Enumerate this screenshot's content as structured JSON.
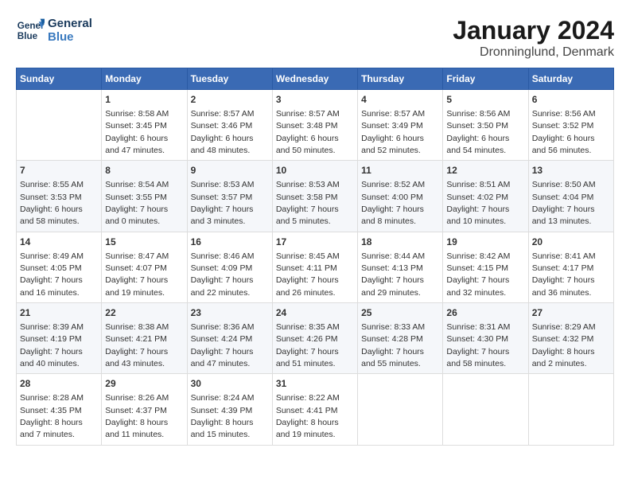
{
  "header": {
    "logo_text_line1": "General",
    "logo_text_line2": "Blue",
    "title": "January 2024",
    "subtitle": "Dronninglund, Denmark"
  },
  "calendar": {
    "days_of_week": [
      "Sunday",
      "Monday",
      "Tuesday",
      "Wednesday",
      "Thursday",
      "Friday",
      "Saturday"
    ],
    "weeks": [
      [
        {
          "day": "",
          "sunrise": "",
          "sunset": "",
          "daylight": ""
        },
        {
          "day": "1",
          "sunrise": "Sunrise: 8:58 AM",
          "sunset": "Sunset: 3:45 PM",
          "daylight": "Daylight: 6 hours and 47 minutes."
        },
        {
          "day": "2",
          "sunrise": "Sunrise: 8:57 AM",
          "sunset": "Sunset: 3:46 PM",
          "daylight": "Daylight: 6 hours and 48 minutes."
        },
        {
          "day": "3",
          "sunrise": "Sunrise: 8:57 AM",
          "sunset": "Sunset: 3:48 PM",
          "daylight": "Daylight: 6 hours and 50 minutes."
        },
        {
          "day": "4",
          "sunrise": "Sunrise: 8:57 AM",
          "sunset": "Sunset: 3:49 PM",
          "daylight": "Daylight: 6 hours and 52 minutes."
        },
        {
          "day": "5",
          "sunrise": "Sunrise: 8:56 AM",
          "sunset": "Sunset: 3:50 PM",
          "daylight": "Daylight: 6 hours and 54 minutes."
        },
        {
          "day": "6",
          "sunrise": "Sunrise: 8:56 AM",
          "sunset": "Sunset: 3:52 PM",
          "daylight": "Daylight: 6 hours and 56 minutes."
        }
      ],
      [
        {
          "day": "7",
          "sunrise": "Sunrise: 8:55 AM",
          "sunset": "Sunset: 3:53 PM",
          "daylight": "Daylight: 6 hours and 58 minutes."
        },
        {
          "day": "8",
          "sunrise": "Sunrise: 8:54 AM",
          "sunset": "Sunset: 3:55 PM",
          "daylight": "Daylight: 7 hours and 0 minutes."
        },
        {
          "day": "9",
          "sunrise": "Sunrise: 8:53 AM",
          "sunset": "Sunset: 3:57 PM",
          "daylight": "Daylight: 7 hours and 3 minutes."
        },
        {
          "day": "10",
          "sunrise": "Sunrise: 8:53 AM",
          "sunset": "Sunset: 3:58 PM",
          "daylight": "Daylight: 7 hours and 5 minutes."
        },
        {
          "day": "11",
          "sunrise": "Sunrise: 8:52 AM",
          "sunset": "Sunset: 4:00 PM",
          "daylight": "Daylight: 7 hours and 8 minutes."
        },
        {
          "day": "12",
          "sunrise": "Sunrise: 8:51 AM",
          "sunset": "Sunset: 4:02 PM",
          "daylight": "Daylight: 7 hours and 10 minutes."
        },
        {
          "day": "13",
          "sunrise": "Sunrise: 8:50 AM",
          "sunset": "Sunset: 4:04 PM",
          "daylight": "Daylight: 7 hours and 13 minutes."
        }
      ],
      [
        {
          "day": "14",
          "sunrise": "Sunrise: 8:49 AM",
          "sunset": "Sunset: 4:05 PM",
          "daylight": "Daylight: 7 hours and 16 minutes."
        },
        {
          "day": "15",
          "sunrise": "Sunrise: 8:47 AM",
          "sunset": "Sunset: 4:07 PM",
          "daylight": "Daylight: 7 hours and 19 minutes."
        },
        {
          "day": "16",
          "sunrise": "Sunrise: 8:46 AM",
          "sunset": "Sunset: 4:09 PM",
          "daylight": "Daylight: 7 hours and 22 minutes."
        },
        {
          "day": "17",
          "sunrise": "Sunrise: 8:45 AM",
          "sunset": "Sunset: 4:11 PM",
          "daylight": "Daylight: 7 hours and 26 minutes."
        },
        {
          "day": "18",
          "sunrise": "Sunrise: 8:44 AM",
          "sunset": "Sunset: 4:13 PM",
          "daylight": "Daylight: 7 hours and 29 minutes."
        },
        {
          "day": "19",
          "sunrise": "Sunrise: 8:42 AM",
          "sunset": "Sunset: 4:15 PM",
          "daylight": "Daylight: 7 hours and 32 minutes."
        },
        {
          "day": "20",
          "sunrise": "Sunrise: 8:41 AM",
          "sunset": "Sunset: 4:17 PM",
          "daylight": "Daylight: 7 hours and 36 minutes."
        }
      ],
      [
        {
          "day": "21",
          "sunrise": "Sunrise: 8:39 AM",
          "sunset": "Sunset: 4:19 PM",
          "daylight": "Daylight: 7 hours and 40 minutes."
        },
        {
          "day": "22",
          "sunrise": "Sunrise: 8:38 AM",
          "sunset": "Sunset: 4:21 PM",
          "daylight": "Daylight: 7 hours and 43 minutes."
        },
        {
          "day": "23",
          "sunrise": "Sunrise: 8:36 AM",
          "sunset": "Sunset: 4:24 PM",
          "daylight": "Daylight: 7 hours and 47 minutes."
        },
        {
          "day": "24",
          "sunrise": "Sunrise: 8:35 AM",
          "sunset": "Sunset: 4:26 PM",
          "daylight": "Daylight: 7 hours and 51 minutes."
        },
        {
          "day": "25",
          "sunrise": "Sunrise: 8:33 AM",
          "sunset": "Sunset: 4:28 PM",
          "daylight": "Daylight: 7 hours and 55 minutes."
        },
        {
          "day": "26",
          "sunrise": "Sunrise: 8:31 AM",
          "sunset": "Sunset: 4:30 PM",
          "daylight": "Daylight: 7 hours and 58 minutes."
        },
        {
          "day": "27",
          "sunrise": "Sunrise: 8:29 AM",
          "sunset": "Sunset: 4:32 PM",
          "daylight": "Daylight: 8 hours and 2 minutes."
        }
      ],
      [
        {
          "day": "28",
          "sunrise": "Sunrise: 8:28 AM",
          "sunset": "Sunset: 4:35 PM",
          "daylight": "Daylight: 8 hours and 7 minutes."
        },
        {
          "day": "29",
          "sunrise": "Sunrise: 8:26 AM",
          "sunset": "Sunset: 4:37 PM",
          "daylight": "Daylight: 8 hours and 11 minutes."
        },
        {
          "day": "30",
          "sunrise": "Sunrise: 8:24 AM",
          "sunset": "Sunset: 4:39 PM",
          "daylight": "Daylight: 8 hours and 15 minutes."
        },
        {
          "day": "31",
          "sunrise": "Sunrise: 8:22 AM",
          "sunset": "Sunset: 4:41 PM",
          "daylight": "Daylight: 8 hours and 19 minutes."
        },
        {
          "day": "",
          "sunrise": "",
          "sunset": "",
          "daylight": ""
        },
        {
          "day": "",
          "sunrise": "",
          "sunset": "",
          "daylight": ""
        },
        {
          "day": "",
          "sunrise": "",
          "sunset": "",
          "daylight": ""
        }
      ]
    ]
  }
}
